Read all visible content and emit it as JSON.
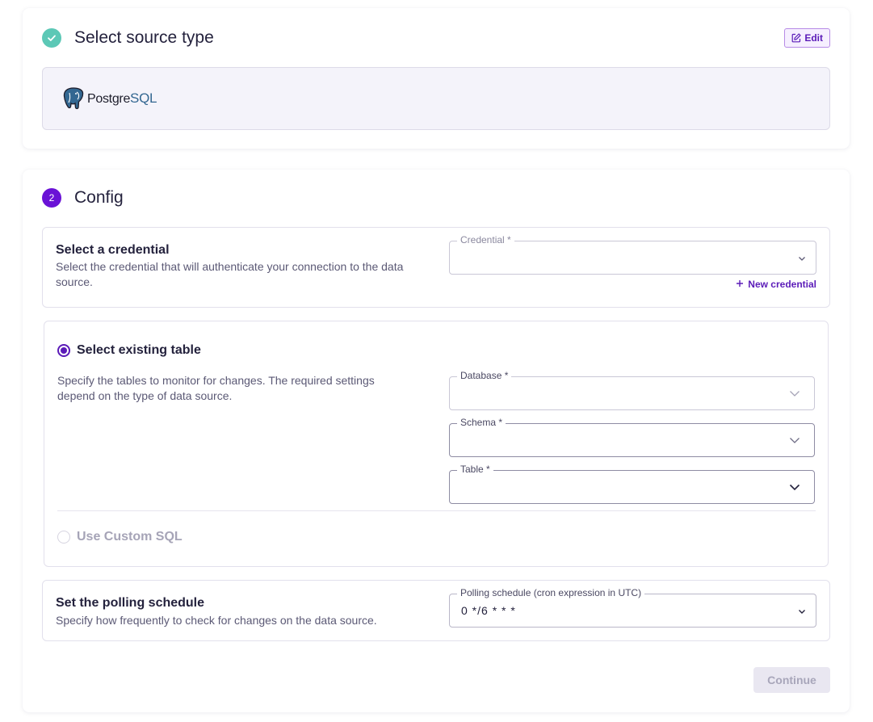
{
  "step1": {
    "title": "Select source type",
    "edit_label": "Edit",
    "source": {
      "prefix": "Postgre",
      "suffix": "SQL"
    }
  },
  "step2": {
    "number": "2",
    "title": "Config",
    "credential": {
      "title": "Select a credential",
      "description": "Select the credential that will authenticate your connection to the data source.",
      "field_label": "Credential *",
      "value": "",
      "new_label": "New credential"
    },
    "existing_table": {
      "option_label": "Select existing table",
      "selected": true,
      "description": "Specify the tables to monitor for changes. The required settings depend on the type of data source.",
      "database_label": "Database *",
      "schema_label": "Schema *",
      "table_label": "Table *"
    },
    "custom_sql": {
      "option_label": "Use Custom SQL",
      "selected": false
    },
    "polling": {
      "title": "Set the polling schedule",
      "description": "Specify how frequently to check for changes on the data source.",
      "field_label": "Polling schedule (cron expression in UTC)",
      "value": "0 */6 * * *"
    },
    "continue_label": "Continue"
  },
  "colors": {
    "accent": "#5b1bb8",
    "step_done": "#5cc8b6",
    "step_active": "#6a12d6"
  }
}
